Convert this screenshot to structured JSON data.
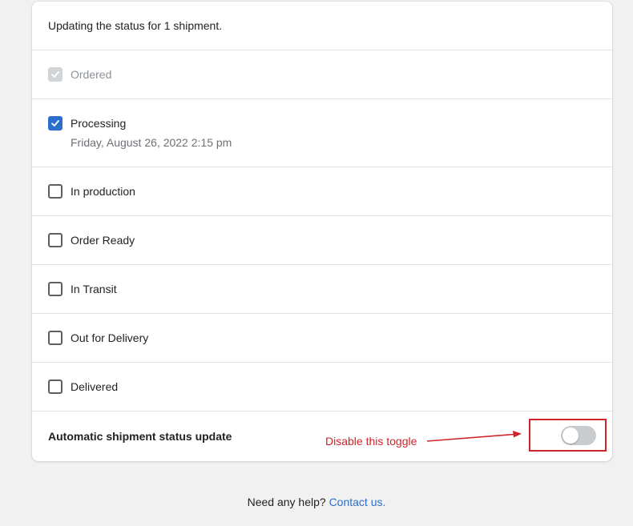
{
  "header": {
    "text": "Updating the status for 1 shipment."
  },
  "statuses": [
    {
      "label": "Ordered",
      "state": "checked-disabled"
    },
    {
      "label": "Processing",
      "state": "checked",
      "timestamp": "Friday, August 26, 2022 2:15 pm"
    },
    {
      "label": "In production",
      "state": "unchecked"
    },
    {
      "label": "Order Ready",
      "state": "unchecked"
    },
    {
      "label": "In Transit",
      "state": "unchecked"
    },
    {
      "label": "Out for Delivery",
      "state": "unchecked"
    },
    {
      "label": "Delivered",
      "state": "unchecked"
    }
  ],
  "auto_update": {
    "label": "Automatic shipment status update",
    "enabled": false
  },
  "annotation": {
    "text": "Disable this toggle",
    "color": "#d0242b"
  },
  "footer": {
    "prefix": "Need any help?",
    "link_label": "Contact us."
  },
  "colors": {
    "accent": "#2c6ecb",
    "background": "#f1f1f1"
  }
}
